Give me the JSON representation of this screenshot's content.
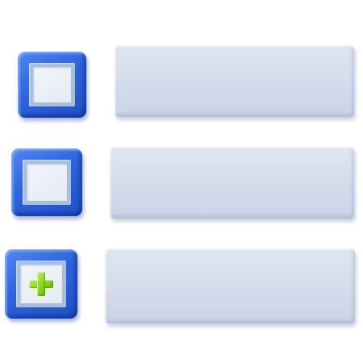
{
  "colors": {
    "tile_blue": "#2f64dc",
    "tile_inner": "#a7bfdf",
    "face": "#eef2f8",
    "plus_green": "#8fd61f",
    "field_gray": "#d3dceb"
  },
  "items": [
    {
      "checkbox_state": "empty",
      "icon": "empty-square-icon"
    },
    {
      "checkbox_state": "empty",
      "icon": "empty-square-icon"
    },
    {
      "checkbox_state": "add",
      "icon": "plus-icon"
    }
  ]
}
